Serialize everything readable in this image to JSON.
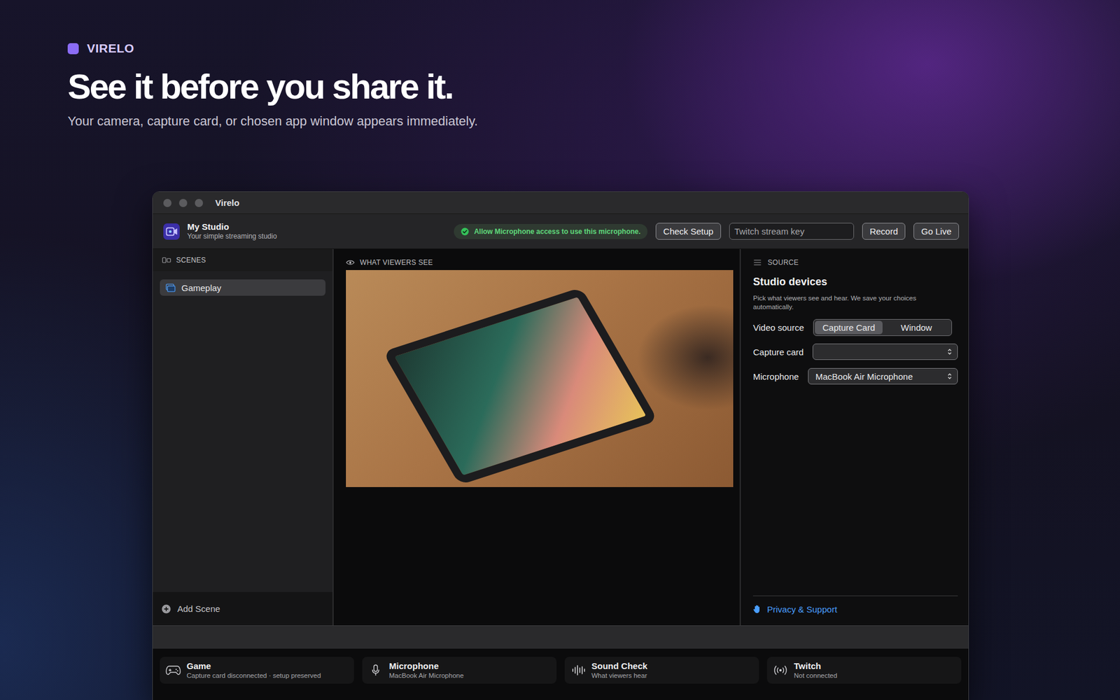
{
  "brand": {
    "name": "VIRELO"
  },
  "hero": {
    "headline": "See it before you share it.",
    "subtitle": "Your camera, capture card, or chosen app window appears immediately."
  },
  "window": {
    "title": "Virelo"
  },
  "toolbar": {
    "studio_name": "My Studio",
    "studio_subtitle": "Your simple streaming studio",
    "notice": "Allow Microphone access to use this microphone.",
    "check_button": "Check Setup",
    "stream_key": {
      "placeholder": "Twitch stream key"
    },
    "action_buttons": [
      "Record",
      "Go Live"
    ]
  },
  "scenes": {
    "header": "SCENES",
    "items": [
      {
        "label": "Gameplay",
        "selected": true
      }
    ],
    "add_label": "Add Scene"
  },
  "preview": {
    "header": "WHAT VIEWERS SEE"
  },
  "source": {
    "header": "SOURCE",
    "title": "Studio devices",
    "description": "Pick what viewers see and hear. We save your choices automatically.",
    "video_source": {
      "label": "Video source",
      "options": [
        {
          "label": "Capture Card",
          "selected": true
        },
        {
          "label": "Window",
          "selected": false
        }
      ]
    },
    "capture_card": {
      "label": "Capture card",
      "value": ""
    },
    "microphone": {
      "label": "Microphone",
      "value": "MacBook Air Microphone"
    },
    "footer_link": "Privacy & Support"
  },
  "status_bar": [
    {
      "kind": "game",
      "title": "Game",
      "detail": "Capture card disconnected · setup preserved"
    },
    {
      "kind": "microphone",
      "title": "Microphone",
      "detail": "MacBook Air Microphone"
    },
    {
      "kind": "sound",
      "title": "Sound Check",
      "detail": "What viewers hear"
    },
    {
      "kind": "twitch",
      "title": "Twitch",
      "detail": "Not connected"
    }
  ]
}
